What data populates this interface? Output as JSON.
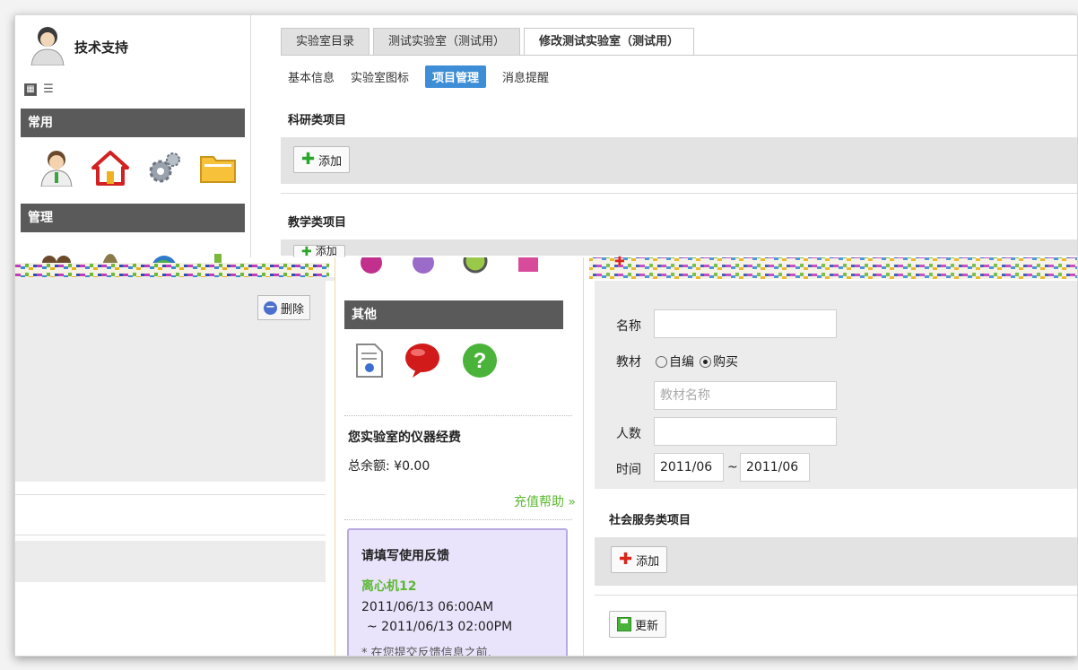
{
  "user": {
    "name": "技术支持"
  },
  "sidebar": {
    "section_common": "常用",
    "section_manage": "管理"
  },
  "tabs": [
    {
      "label": "实验室目录"
    },
    {
      "label": "测试实验室（测试用）"
    },
    {
      "label": "修改测试实验室（测试用）"
    }
  ],
  "subnav": [
    {
      "label": "基本信息"
    },
    {
      "label": "实验室图标"
    },
    {
      "label": "项目管理"
    },
    {
      "label": "消息提醒"
    }
  ],
  "sections": {
    "research": "科研类项目",
    "teaching": "教学类项目",
    "social": "社会服务类项目",
    "add_label": "添加",
    "add_label_partial": "添加",
    "delete_label": "删除",
    "update_label": "更新"
  },
  "mid_panel": {
    "other_title": "其他",
    "budget_title": "您实验室的仪器经费",
    "balance": "总余额: ¥0.00",
    "recharge_help": "充值帮助 »",
    "feedback": {
      "title": "请填写使用反馈",
      "instrument": "离心机12",
      "start": "2011/06/13 06:00AM",
      "end": "~ 2011/06/13 02:00PM",
      "note": "* 在您提交反馈信息之前,"
    }
  },
  "form": {
    "name_label": "名称",
    "name_value": "",
    "textbook_label": "教材",
    "opt_self": "自编",
    "opt_buy": "购买",
    "selected": "购买",
    "textbook_placeholder": "教材名称",
    "people_label": "人数",
    "people_value": "",
    "time_label": "时间",
    "time_from": "2011/06",
    "time_sep": "~",
    "time_to": "2011/06"
  },
  "colors": {
    "accent": "#3d8ed6",
    "header_gray": "#5a5a5a",
    "band_gray": "#e3e3e3",
    "recharge": "#5cb832"
  }
}
